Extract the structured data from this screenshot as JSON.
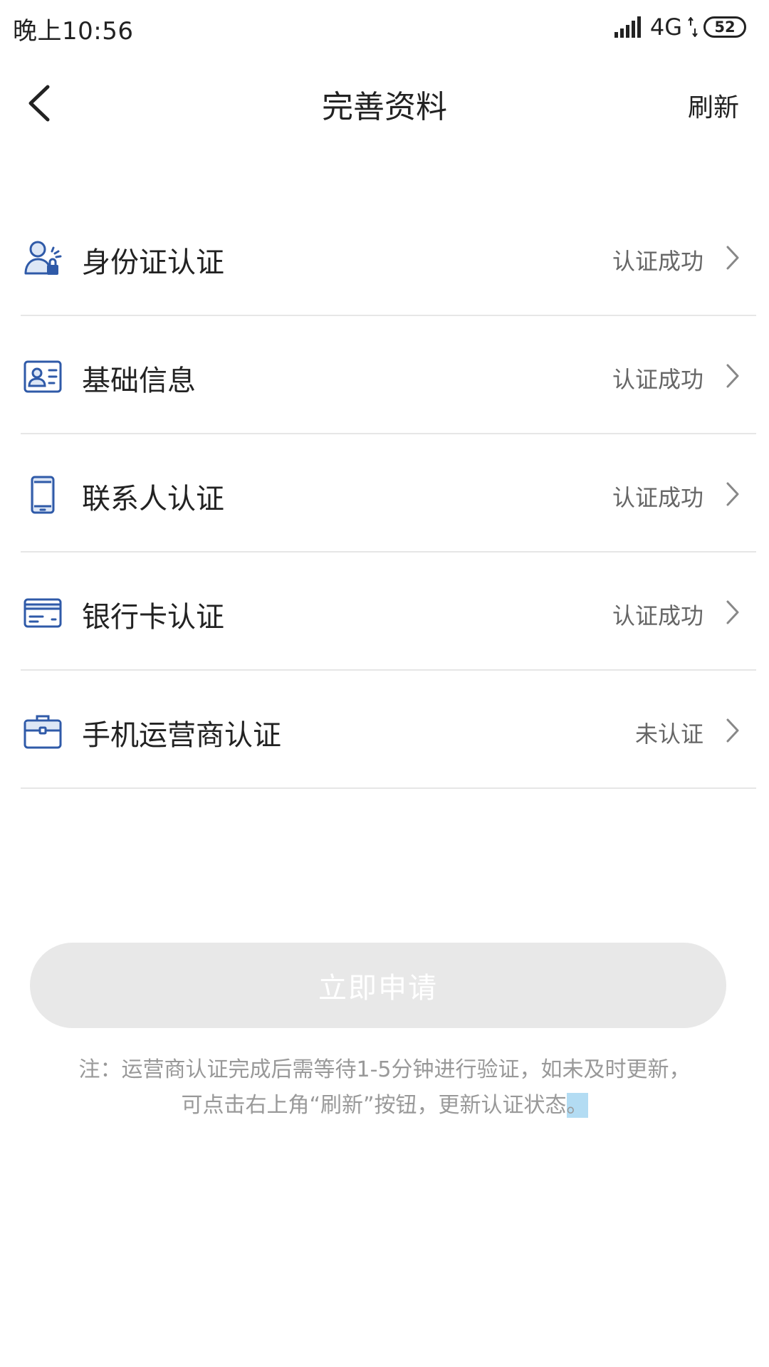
{
  "status_bar": {
    "time": "晚上10:56",
    "network": "4G",
    "battery": "52",
    "icons": [
      "signal-icon",
      "data-arrows-icon",
      "battery-icon"
    ]
  },
  "nav": {
    "title": "完善资料",
    "refresh_label": "刷新",
    "back_icon": "chevron-left-icon"
  },
  "items": [
    {
      "label": "身份证认证",
      "status": "认证成功",
      "icon": "id-person-icon"
    },
    {
      "label": "基础信息",
      "status": "认证成功",
      "icon": "profile-card-icon"
    },
    {
      "label": "联系人认证",
      "status": "认证成功",
      "icon": "phone-icon"
    },
    {
      "label": "银行卡认证",
      "status": "认证成功",
      "icon": "bank-card-icon"
    },
    {
      "label": "手机运营商认证",
      "status": "未认证",
      "icon": "briefcase-icon"
    }
  ],
  "apply_button": {
    "label": "立即申请",
    "enabled": false
  },
  "note": {
    "line1": "注：运营商认证完成后需等待1-5分钟进行验证，如未及时更新，",
    "line2": "可点击右上角“刷新”按钮，更新认证状态",
    "line2_end": "。"
  },
  "colors": {
    "icon_blue": "#2f5aa8",
    "icon_fill": "#dde7f6",
    "divider": "#e6e6e6",
    "button_disabled": "#e8e8e8",
    "note_text": "#999999",
    "status_text": "#666666"
  }
}
